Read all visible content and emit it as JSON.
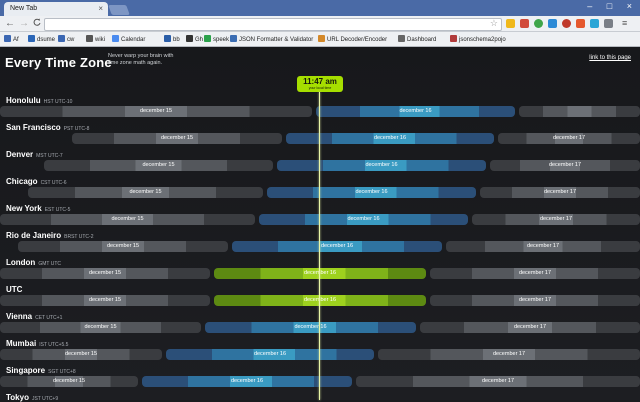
{
  "browser": {
    "tab_title": "New Tab",
    "tab_close": "×",
    "window_controls": "– □ ×",
    "back": "←",
    "forward": "→",
    "bookmark_star": "☆",
    "bookmarks": [
      {
        "label": "Af",
        "color": "#3b67b3"
      },
      {
        "label": "dsume",
        "color": "#2b66b7"
      },
      {
        "label": "cw",
        "color": "#3b67b3"
      },
      {
        "label": "wiki",
        "color": "#555555"
      },
      {
        "label": "Calendar",
        "color": "#4a8bf0"
      },
      {
        "label": "bb",
        "color": "#2a5da8"
      },
      {
        "label": "Gh",
        "color": "#333333"
      },
      {
        "label": "speek",
        "color": "#2ba14b"
      },
      {
        "label": "JSON Formatter & Validator",
        "color": "#3b6db3"
      },
      {
        "label": "URL Decoder/Encoder",
        "color": "#d4892a"
      },
      {
        "label": "Dashboard",
        "color": "#666666"
      },
      {
        "label": "jsonschema2pojo",
        "color": "#b13b3b"
      }
    ]
  },
  "page": {
    "title": "Every Time Zone",
    "tagline": "Never warp your brain with time zone math again.",
    "link": "link to this page",
    "clock_time": "11:47 am",
    "clock_sub": "your local time"
  },
  "zones": [
    {
      "name": "Honolulu",
      "sub": "HST UTC-10",
      "bars": [
        {
          "label": "december 15",
          "type": "gray"
        },
        {
          "label": "december 16",
          "type": "blue"
        },
        {
          "label": "",
          "type": "gray"
        }
      ]
    },
    {
      "name": "San Francisco",
      "sub": "PST UTC-8",
      "bars": [
        {
          "label": "december 15",
          "type": "gray"
        },
        {
          "label": "december 16",
          "type": "blue"
        },
        {
          "label": "december 17",
          "type": "gray"
        }
      ]
    },
    {
      "name": "Denver",
      "sub": "MST UTC-7",
      "bars": [
        {
          "label": "december 15",
          "type": "gray"
        },
        {
          "label": "december 16",
          "type": "blue"
        },
        {
          "label": "december 17",
          "type": "gray"
        }
      ]
    },
    {
      "name": "Chicago",
      "sub": "CST UTC-6",
      "bars": [
        {
          "label": "december 15",
          "type": "gray"
        },
        {
          "label": "december 16",
          "type": "blue"
        },
        {
          "label": "december 17",
          "type": "gray"
        }
      ]
    },
    {
      "name": "New York",
      "sub": "EST UTC-5",
      "bars": [
        {
          "label": "december 15",
          "type": "gray"
        },
        {
          "label": "december 16",
          "type": "blue"
        },
        {
          "label": "december 17",
          "type": "gray"
        }
      ]
    },
    {
      "name": "Rio de Janeiro",
      "sub": "BRST UTC-2",
      "bars": [
        {
          "label": "december 15",
          "type": "gray"
        },
        {
          "label": "december 16",
          "type": "blue"
        },
        {
          "label": "december 17",
          "type": "gray"
        }
      ]
    },
    {
      "name": "London",
      "sub": "GMT UTC",
      "bars": [
        {
          "label": "december 15",
          "type": "gray"
        },
        {
          "label": "december 16",
          "type": "green"
        },
        {
          "label": "december 17",
          "type": "gray"
        }
      ]
    },
    {
      "name": "UTC",
      "sub": "",
      "bars": [
        {
          "label": "december 15",
          "type": "gray"
        },
        {
          "label": "december 16",
          "type": "green"
        },
        {
          "label": "december 17",
          "type": "gray"
        }
      ]
    },
    {
      "name": "Vienna",
      "sub": "CET UTC+1",
      "bars": [
        {
          "label": "december 15",
          "type": "gray"
        },
        {
          "label": "december 16",
          "type": "blue"
        },
        {
          "label": "december 17",
          "type": "gray"
        }
      ]
    },
    {
      "name": "Mumbai",
      "sub": "IST UTC+5.5",
      "bars": [
        {
          "label": "december 15",
          "type": "gray"
        },
        {
          "label": "december 16",
          "type": "blue"
        },
        {
          "label": "december 17",
          "type": "gray"
        }
      ]
    },
    {
      "name": "Singapore",
      "sub": "SGT UTC+8",
      "bars": [
        {
          "label": "december 15",
          "type": "gray"
        },
        {
          "label": "december 16",
          "type": "blue"
        },
        {
          "label": "december 17",
          "type": "gray"
        }
      ]
    },
    {
      "name": "Tokyo",
      "sub": "JST UTC+9",
      "bars": []
    }
  ]
}
